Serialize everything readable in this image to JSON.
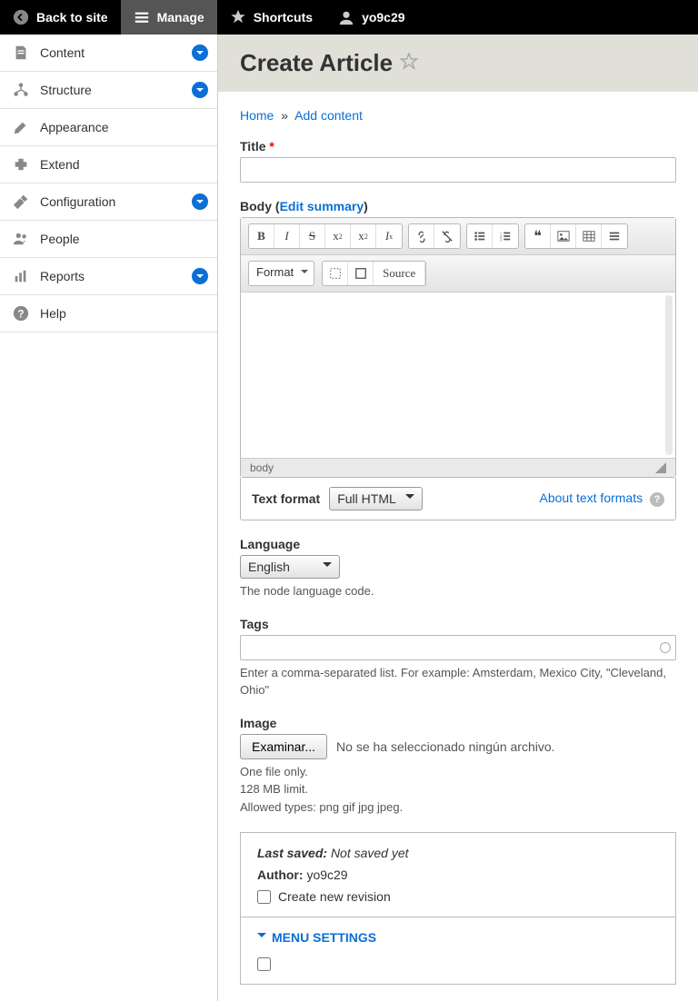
{
  "toolbar": {
    "back": "Back to site",
    "manage": "Manage",
    "shortcuts": "Shortcuts",
    "user": "yo9c29"
  },
  "sidebar": {
    "items": [
      {
        "label": "Content",
        "expandable": true
      },
      {
        "label": "Structure",
        "expandable": true
      },
      {
        "label": "Appearance",
        "expandable": false
      },
      {
        "label": "Extend",
        "expandable": false
      },
      {
        "label": "Configuration",
        "expandable": true
      },
      {
        "label": "People",
        "expandable": false
      },
      {
        "label": "Reports",
        "expandable": true
      },
      {
        "label": "Help",
        "expandable": false
      }
    ]
  },
  "page": {
    "title": "Create Article"
  },
  "breadcrumb": {
    "home": "Home",
    "sep": "»",
    "add": "Add content"
  },
  "form": {
    "title_label": "Title",
    "body_label": "Body",
    "edit_summary": "Edit summary",
    "editor_path": "body",
    "format_btn": "Format",
    "source_btn": "Source",
    "tf_label": "Text format",
    "tf_value": "Full HTML",
    "about_formats": "About text formats",
    "lang_label": "Language",
    "lang_value": "English",
    "lang_desc": "The node language code.",
    "tags_label": "Tags",
    "tags_desc": "Enter a comma-separated list. For example: Amsterdam, Mexico City, \"Cleveland, Ohio\"",
    "image_label": "Image",
    "file_btn": "Examinar...",
    "file_none": "No se ha seleccionado ningún archivo.",
    "image_desc1": "One file only.",
    "image_desc2": "128 MB limit.",
    "image_desc3": "Allowed types: png gif jpg jpeg."
  },
  "settings": {
    "last_saved_label": "Last saved:",
    "last_saved_value": "Not saved yet",
    "author_label": "Author:",
    "author_value": "yo9c29",
    "revision_label": "Create new revision",
    "menu_settings": "Menu settings"
  }
}
